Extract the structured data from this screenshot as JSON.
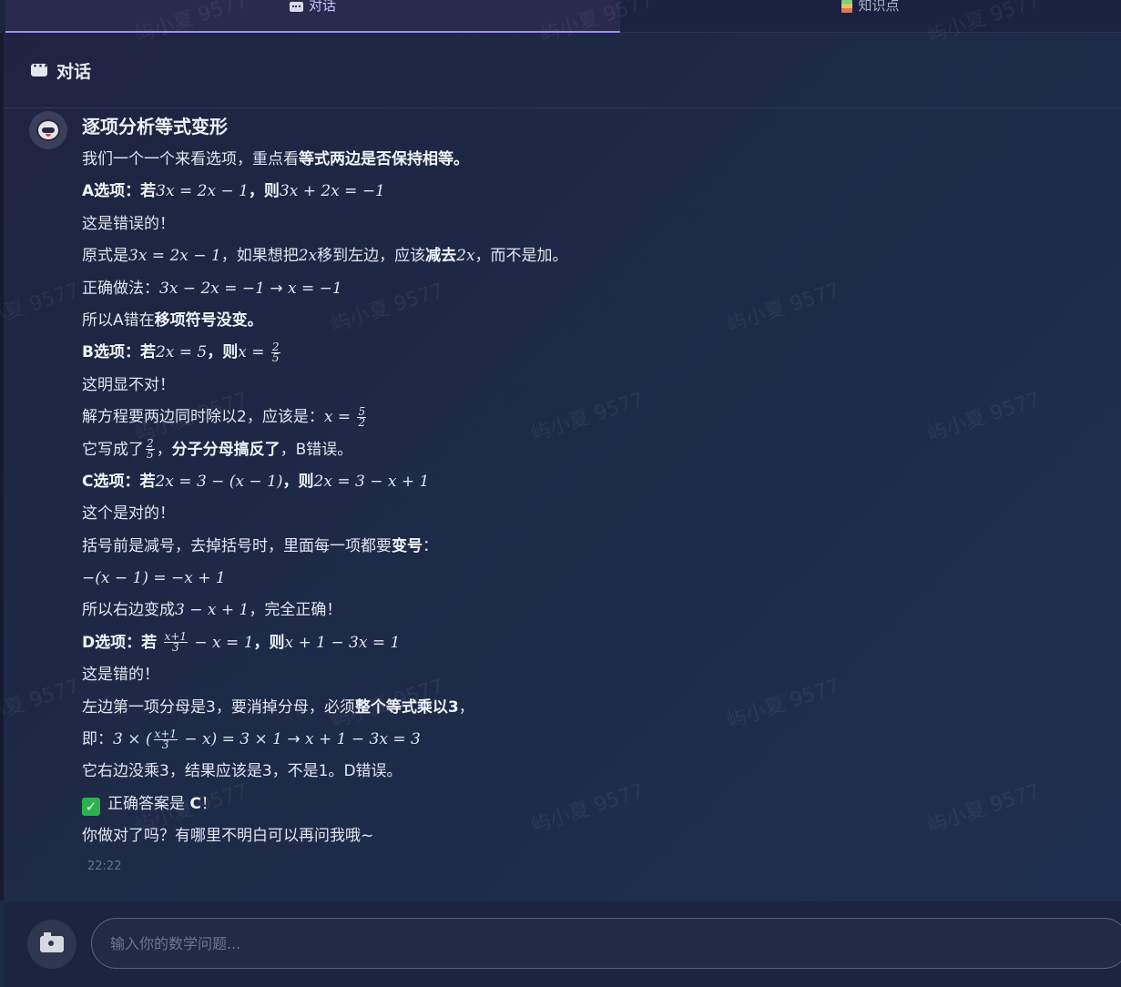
{
  "tabs": [
    {
      "label": "对话",
      "icon": "chat-bubble-icon",
      "active": true
    },
    {
      "label": "知识点",
      "icon": "books-icon",
      "active": false
    }
  ],
  "header": {
    "title": "对话",
    "icon": "chat-bubble-icon"
  },
  "message": {
    "title": "逐项分析等式变形",
    "intro": {
      "a": "我们一个一个来看选项，重点看",
      "b": "等式两边是否保持相等。"
    },
    "a": {
      "q": {
        "a": "A选项：若",
        "m1": "3x = 2x − 1",
        "b": "，则",
        "m2": "3x + 2x = −1"
      },
      "verdict": "这是错误的！",
      "explain": {
        "a": "原式是",
        "m1": "3x = 2x − 1",
        "b": "，如果想把",
        "m2": "2x",
        "c": "移到左边，应该",
        "d": "减去",
        "m3": "2x",
        "e": "，而不是加。"
      },
      "correct": {
        "a": "正确做法：",
        "m1": "3x − 2x = −1",
        "arrow": "→",
        "m2": "x = −1"
      },
      "summary": {
        "a": "所以A错在",
        "b": "移项符号没变。"
      }
    },
    "b": {
      "q": {
        "a": "B选项：若",
        "m1": "2x = 5",
        "b": "，则",
        "m2": "x =",
        "num": "2",
        "den": "5"
      },
      "verdict": "这明显不对！",
      "explain": {
        "a": "解方程要两边同时除以2，应该是：",
        "m1": "x =",
        "num": "5",
        "den": "2"
      },
      "summary": {
        "a": "它写成了",
        "num": "2",
        "den": "5",
        "b": "，",
        "c": "分子分母搞反了",
        "d": "，B错误。"
      }
    },
    "c": {
      "q": {
        "a": "C选项：若",
        "m1": "2x = 3 − (x − 1)",
        "b": "，则",
        "m2": "2x = 3 − x + 1"
      },
      "verdict": "这个是对的！",
      "explain": {
        "a": "括号前是减号，去掉括号时，里面每一项都要",
        "b": "变号",
        "c": "："
      },
      "formula": "−(x − 1) = −x + 1",
      "summary": {
        "a": "所以右边变成",
        "m1": "3 − x + 1",
        "b": "，完全正确！"
      }
    },
    "d": {
      "q": {
        "a": "D选项：若",
        "num": "x+1",
        "den": "3",
        "m1": "− x = 1",
        "b": "，则",
        "m2": "x + 1 − 3x = 1"
      },
      "verdict": "这是错的！",
      "explain": {
        "a": "左边第一项分母是3，要消掉分母，必须",
        "b": "整个等式乘以3",
        "c": "，"
      },
      "calc": {
        "a": "即：",
        "m1": "3 × (",
        "num": "x+1",
        "den": "3",
        "m2": "− x) = 3 × 1",
        "arrow": "→",
        "m3": "x + 1 − 3x = 3"
      },
      "summary": "它右边没乘3，结果应该是3，不是1。D错误。"
    },
    "answer": {
      "a": "正确答案是 ",
      "b": "C",
      "c": "！"
    },
    "closing": "你做对了吗？有哪里不明白可以再问我哦~",
    "time": "22:22"
  },
  "input": {
    "placeholder": "输入你的数学问题..."
  },
  "watermark": "屿小夏 9577",
  "colors": {
    "accent": "#9d8cf0",
    "check": "#2bb24c",
    "background": "#1e2a48"
  }
}
